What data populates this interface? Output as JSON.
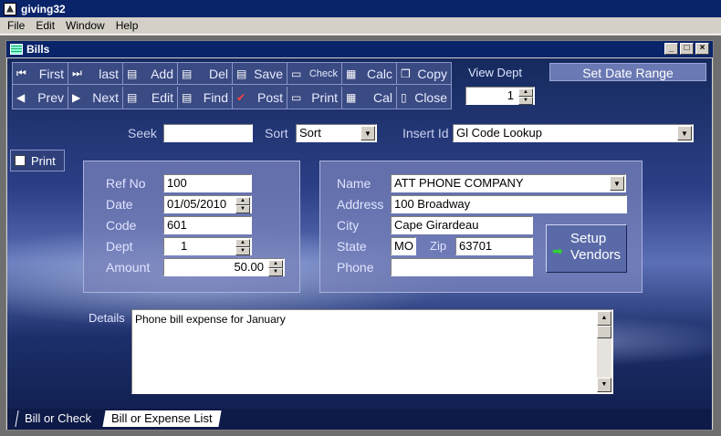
{
  "app": {
    "title": "giving32"
  },
  "menu": [
    "File",
    "Edit",
    "Window",
    "Help"
  ],
  "window": {
    "title": "Bills"
  },
  "toolbar": {
    "row1": [
      {
        "icon": "first-record-icon",
        "glyph": "⏮",
        "label": "First"
      },
      {
        "icon": "last-record-icon",
        "glyph": "⏭",
        "label": "last"
      },
      {
        "icon": "add-icon",
        "glyph": "▤",
        "label": "Add"
      },
      {
        "icon": "delete-icon",
        "glyph": "▤",
        "label": "Del"
      },
      {
        "icon": "save-icon",
        "glyph": "▤",
        "label": "Save"
      },
      {
        "icon": "check-icon",
        "glyph": "▭",
        "label": "Check"
      },
      {
        "icon": "calculator-icon",
        "glyph": "▦",
        "label": "Calc"
      },
      {
        "icon": "copy-icon",
        "glyph": "❐",
        "label": "Copy"
      }
    ],
    "row2": [
      {
        "icon": "prev-record-icon",
        "glyph": "◀",
        "label": "Prev"
      },
      {
        "icon": "next-record-icon",
        "glyph": "▶",
        "label": "Next"
      },
      {
        "icon": "edit-icon",
        "glyph": "▤",
        "label": "Edit"
      },
      {
        "icon": "find-icon",
        "glyph": "▤",
        "label": "Find"
      },
      {
        "icon": "post-icon",
        "glyph": "✔",
        "label": "Post"
      },
      {
        "icon": "printer-icon",
        "glyph": "▭",
        "label": "Print"
      },
      {
        "icon": "calendar-icon",
        "glyph": "▦",
        "label": "Cal"
      },
      {
        "icon": "close-door-icon",
        "glyph": "▯",
        "label": "Close"
      }
    ]
  },
  "view_dept": {
    "label": "View Dept",
    "value": "1"
  },
  "set_date_range": "Set Date Range",
  "seek": {
    "label": "Seek",
    "value": ""
  },
  "sort": {
    "label": "Sort",
    "value": "Sort"
  },
  "insert_id": {
    "label": "Insert Id",
    "value": "Gl Code Lookup"
  },
  "print_toggle": "Print",
  "bill": {
    "ref_no_label": "Ref No",
    "ref_no": "100",
    "date_label": "Date",
    "date": "01/05/2010",
    "code_label": "Code",
    "code": "601",
    "dept_label": "Dept",
    "dept": "1",
    "amount_label": "Amount",
    "amount": "50.00"
  },
  "vendor": {
    "name_label": "Name",
    "name": "ATT PHONE COMPANY",
    "address_label": "Address",
    "address": "100 Broadway",
    "city_label": "City",
    "city": "Cape Girardeau",
    "state_label": "State",
    "state": "MO",
    "zip_label": "Zip",
    "zip": "63701",
    "phone_label": "Phone",
    "phone": ""
  },
  "setup_vendors": {
    "line1": "Setup",
    "line2": "Vendors"
  },
  "details": {
    "label": "Details",
    "value": "Phone bill expense for January"
  },
  "tabs": [
    "Bill or Check",
    "Bill or Expense List"
  ]
}
